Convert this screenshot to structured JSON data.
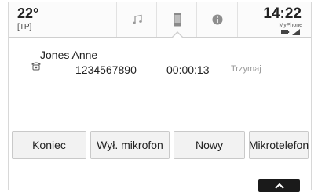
{
  "status": {
    "temperature": "22°",
    "radio_flag": "[TP]",
    "time": "14:22",
    "carrier": "MyPhone"
  },
  "tabs": [
    {
      "icon": "music-note-icon"
    },
    {
      "icon": "phone-icon",
      "active": true
    },
    {
      "icon": "info-icon"
    }
  ],
  "call": {
    "name": "Jones Anne",
    "number": "1234567890",
    "duration": "00:00:13",
    "hold_label": "Trzymaj"
  },
  "actions": {
    "end_label": "Koniec",
    "mute_label": "Wył. mikrofon",
    "new_label": "Nowy",
    "handset_label": "Mikrotelefon"
  },
  "footer": {
    "scroll_up_icon": "chevron-up-icon"
  }
}
